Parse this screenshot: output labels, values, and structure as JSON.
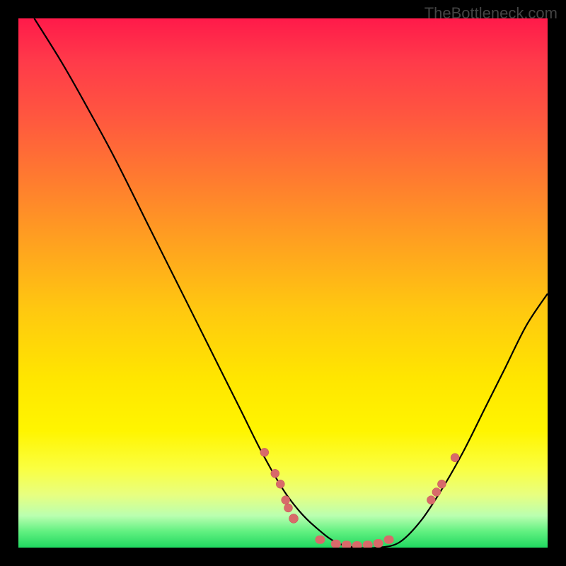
{
  "watermark": "TheBottleneck.com",
  "chart_data": {
    "type": "line",
    "title": "",
    "xlabel": "",
    "ylabel": "",
    "xlim": [
      0,
      100
    ],
    "ylim": [
      0,
      100
    ],
    "series": [
      {
        "name": "curve",
        "x": [
          3,
          8,
          12,
          18,
          24,
          30,
          36,
          42,
          46,
          50,
          53,
          56,
          60,
          64,
          68,
          72,
          76,
          80,
          84,
          88,
          92,
          96,
          100
        ],
        "y": [
          100,
          92,
          85,
          74,
          62,
          50,
          38,
          26,
          18,
          11,
          7,
          4,
          1,
          0,
          0,
          1,
          5,
          11,
          18,
          26,
          34,
          42,
          48
        ]
      }
    ],
    "markers": [
      {
        "x": 46.5,
        "y": 18
      },
      {
        "x": 48.5,
        "y": 14
      },
      {
        "x": 49.5,
        "y": 12
      },
      {
        "x": 50.5,
        "y": 9
      },
      {
        "x": 51,
        "y": 7.5
      },
      {
        "x": 52,
        "y": 5.5
      },
      {
        "x": 57,
        "y": 1.5
      },
      {
        "x": 60,
        "y": 0.7
      },
      {
        "x": 62,
        "y": 0.5
      },
      {
        "x": 64,
        "y": 0.4
      },
      {
        "x": 66,
        "y": 0.5
      },
      {
        "x": 68,
        "y": 0.8
      },
      {
        "x": 70,
        "y": 1.5
      },
      {
        "x": 78,
        "y": 9
      },
      {
        "x": 79,
        "y": 10.5
      },
      {
        "x": 80,
        "y": 12
      },
      {
        "x": 82.5,
        "y": 17
      }
    ],
    "gradient_colors": {
      "top": "#ff1a4a",
      "mid_upper": "#ff7a30",
      "mid": "#ffe600",
      "mid_lower": "#faff40",
      "bottom": "#20d860"
    }
  }
}
